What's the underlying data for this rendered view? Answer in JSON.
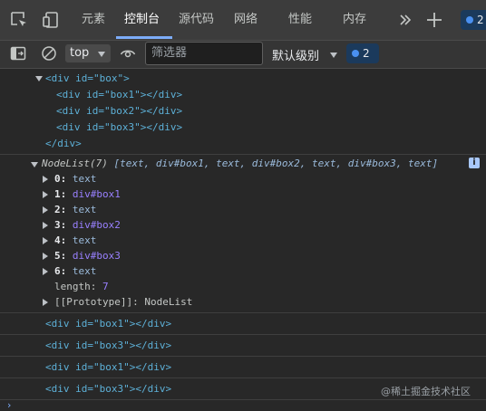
{
  "tabs": [
    {
      "label": "元素"
    },
    {
      "label": "控制台"
    },
    {
      "label": "源代码"
    },
    {
      "label": "网络"
    },
    {
      "label": "性能"
    },
    {
      "label": "内存"
    }
  ],
  "header_badge": {
    "count": "2"
  },
  "toolbar": {
    "context": "top",
    "filter_placeholder": "筛选器",
    "levels_label": "默认级别",
    "issues_count": "2"
  },
  "console": {
    "box_open": "<div id=\"box\">",
    "box_children": [
      "<div id=\"box1\"></div>",
      "<div id=\"box2\"></div>",
      "<div id=\"box3\"></div>"
    ],
    "box_close": "</div>",
    "nodelist_name": "NodeList(7)",
    "nodelist_preview": "[text, div#box1, text, div#box2, text, div#box3, text]",
    "items": [
      {
        "key": "0:",
        "value": "text"
      },
      {
        "key": "1:",
        "value": "div#box1"
      },
      {
        "key": "2:",
        "value": "text"
      },
      {
        "key": "3:",
        "value": "div#box2"
      },
      {
        "key": "4:",
        "value": "text"
      },
      {
        "key": "5:",
        "value": "div#box3"
      },
      {
        "key": "6:",
        "value": "text"
      }
    ],
    "length_key": "length:",
    "length_value": "7",
    "prototype_key": "[[Prototype]]:",
    "prototype_value": "NodeList",
    "logs": [
      "<div id=\"box1\"></div>",
      "<div id=\"box3\"></div>",
      "<div id=\"box1\"></div>",
      "<div id=\"box3\"></div>"
    ]
  },
  "watermark": "@稀土掘金技术社区"
}
